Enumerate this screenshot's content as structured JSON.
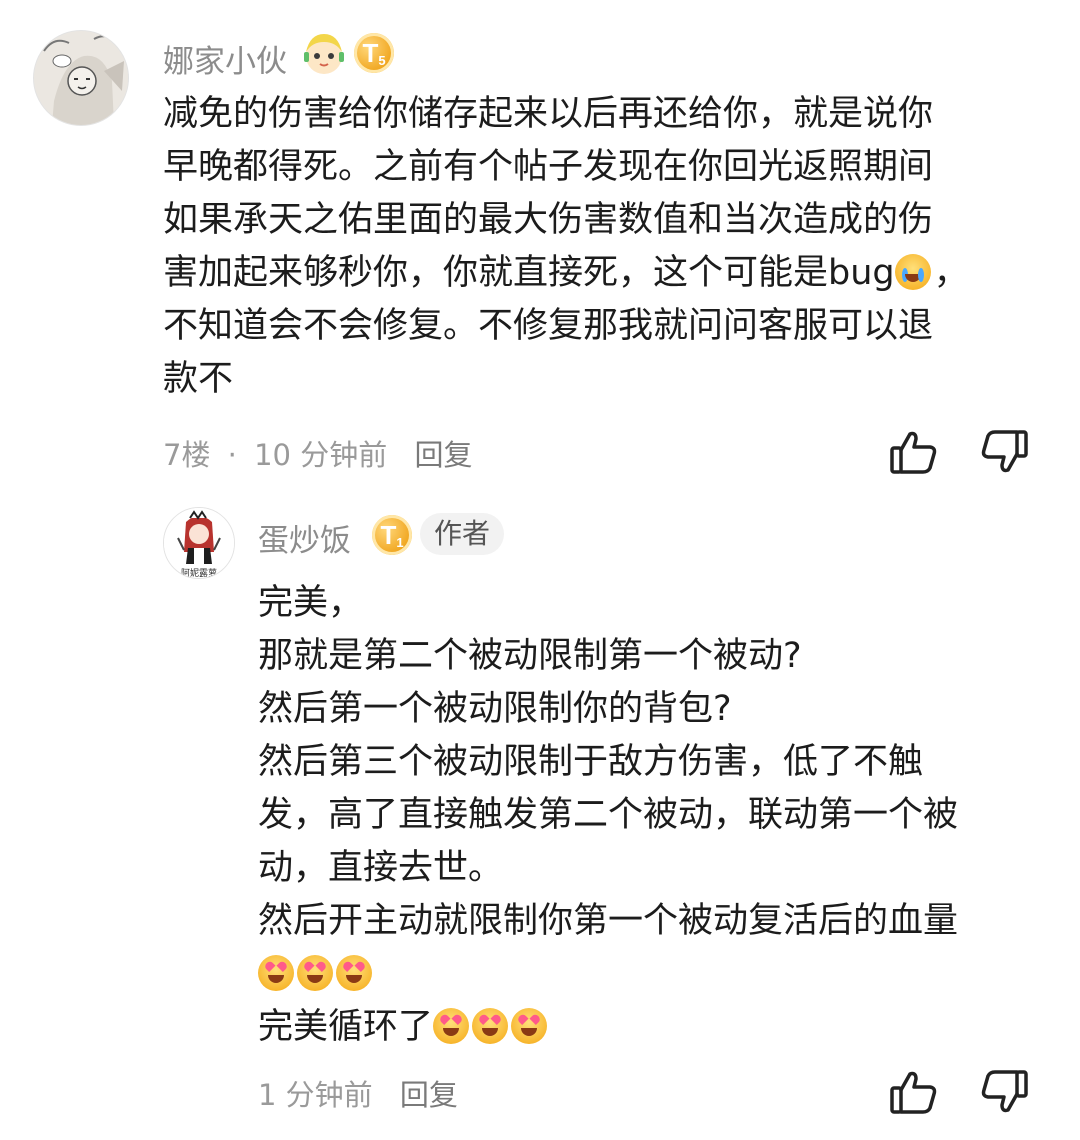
{
  "comment1": {
    "username": "娜家小伙",
    "level_badge": "T",
    "level_num": "5",
    "lines": [
      "减免的伤害给你储存起来以后再还给你，就是说你",
      "早晚都得死。之前有个帖子发现在你回光返照期间",
      "如果承天之佑里面的最大伤害数值和当次造成的伤",
      "害加起来够秒你，你就直接死，这个可能是bug",
      "不知道会不会修复。不修复那我就问问客服可以退",
      "款不"
    ],
    "line4_tail": "，",
    "floor": "7楼",
    "separator": "·",
    "time": "10 分钟前",
    "reply_label": "回复",
    "emoji": "loudly-crying-emoji"
  },
  "comment2": {
    "username": "蛋炒饭",
    "level_badge": "T",
    "level_num": "1",
    "author_tag": "作者",
    "avatar_caption": "阿妮露萝",
    "lines": [
      "完美，",
      "那就是第二个被动限制第一个被动?",
      "然后第一个被动限制你的背包?",
      "然后第三个被动限制于敌方伤害，低了不触",
      "发，高了直接触发第二个被动，联动第一个被",
      "动，直接去世。",
      "然后开主动就限制你第一个被动复活后的血量"
    ],
    "line_last": "完美循环了",
    "time": "1 分钟前",
    "reply_label": "回复",
    "emoji": "heart-eyes-emoji"
  },
  "colors": {
    "username": "#8c8c8c",
    "meta": "#9a9a9a",
    "badge": "#f0a51e",
    "text": "#1c1c1c"
  }
}
